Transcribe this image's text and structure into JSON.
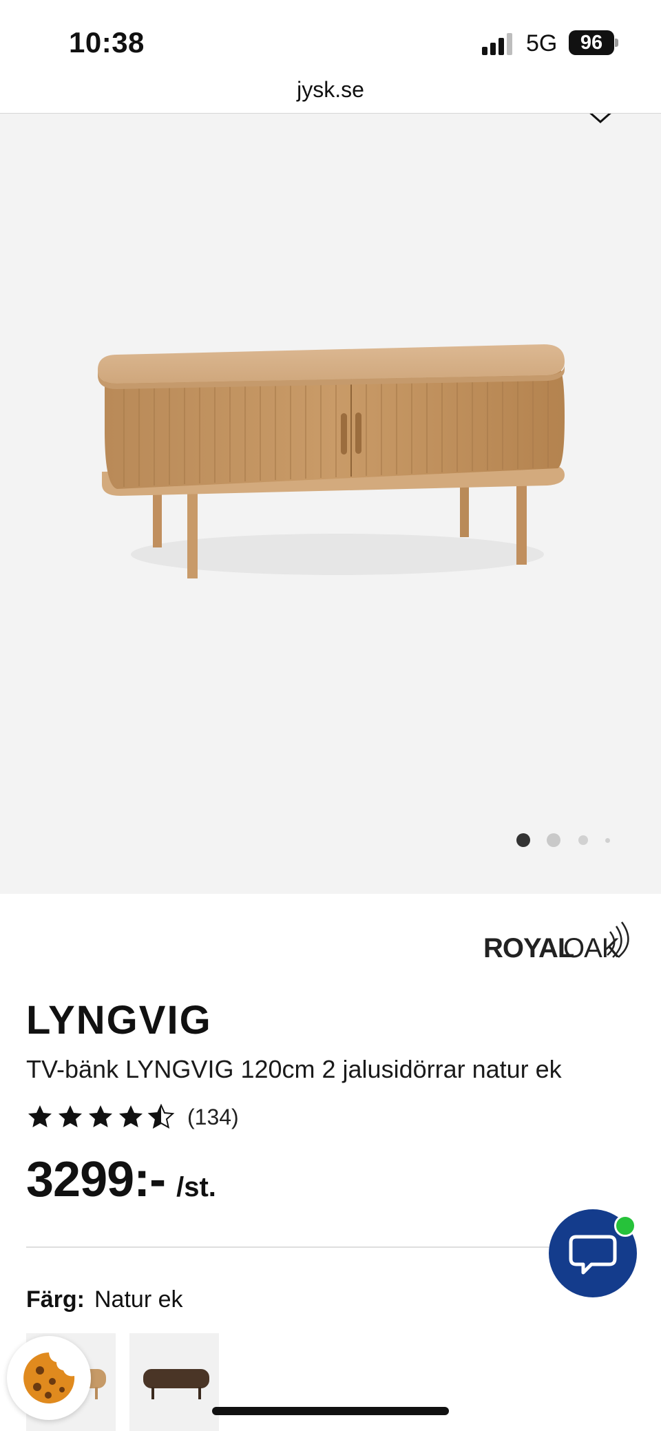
{
  "status_bar": {
    "time": "10:38",
    "network": "5G",
    "battery": "96"
  },
  "browser": {
    "url": "jysk.se"
  },
  "gallery": {
    "slide_count": 4,
    "active_slide": 1
  },
  "product": {
    "brand": "ROYALOAK",
    "title": "LYNGVIG",
    "subtitle": "TV-bänk LYNGVIG 120cm 2 jalusidörrar natur ek",
    "rating": 4.5,
    "rating_max": 5,
    "review_count": "(134)",
    "price": "3299:-",
    "unit": "/st."
  },
  "color": {
    "label": "Färg:",
    "value": "Natur ek"
  },
  "colors": {
    "accent": "#143c8c",
    "online": "#26c23a",
    "wood_light": "#c69a67",
    "wood_dark": "#4a3526"
  },
  "icons": {
    "chat": "chat-bubble-icon",
    "cookie": "cookie-icon",
    "chevron": "chevron-down-icon"
  }
}
